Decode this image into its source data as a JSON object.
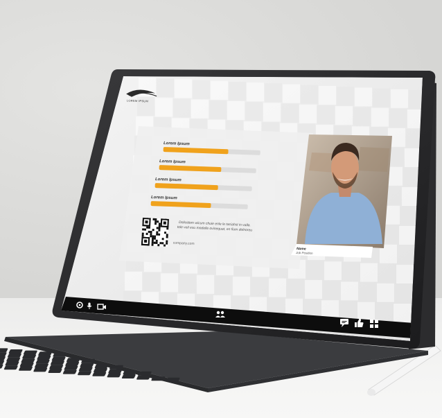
{
  "logo": {
    "text": "LOREM IPSUM"
  },
  "progress": [
    {
      "label": "Lorem Ipsum",
      "value": 0.67
    },
    {
      "label": "Lorem Ipsum",
      "value": 0.64
    },
    {
      "label": "Lorem Ipsum",
      "value": 0.65
    },
    {
      "label": "Lorem Ipsum",
      "value": 0.62
    }
  ],
  "info": {
    "caption_line1": "Dolicidem wicum chuie enle le taciahst in valla.",
    "caption_line2": "tole veil esu modelle ovinequat, en fium dolnoreu",
    "url": "company.com"
  },
  "speaker": {
    "name": "Name",
    "position": "Job Position"
  },
  "colors": {
    "accent": "#f0a21c",
    "track": "#dcdcdc",
    "toolbar": "#0d0d0d"
  },
  "toolbar": {
    "left_icons": [
      "gear-icon",
      "microphone-icon",
      "camera-icon"
    ],
    "center_icon": "participants-icon",
    "right_icons": [
      "chat-icon",
      "thumbs-up-icon",
      "grid-icon"
    ]
  }
}
